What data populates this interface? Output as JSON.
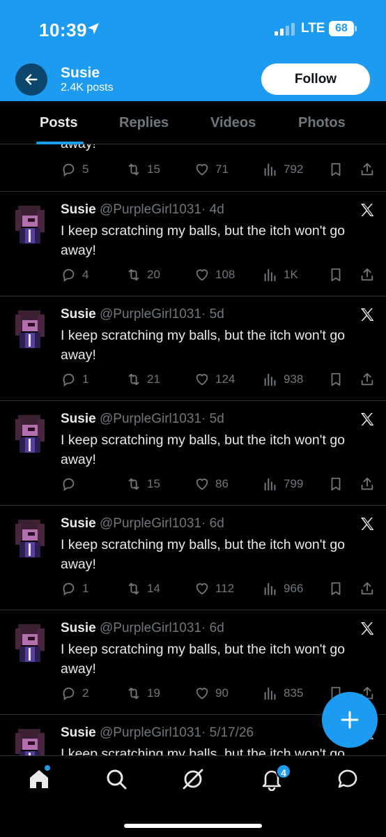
{
  "status_bar": {
    "time": "10:39",
    "network": "LTE",
    "battery": "68"
  },
  "header": {
    "name": "Susie",
    "post_count": "2.4K posts",
    "follow_label": "Follow"
  },
  "tabs": [
    "Posts",
    "Replies",
    "Videos",
    "Photos"
  ],
  "partial_tweet": {
    "text_tail": "away!",
    "replies": "5",
    "reposts": "15",
    "likes": "71",
    "views": "792"
  },
  "tweets": [
    {
      "name": "Susie",
      "handle": "@PurpleGirl1031",
      "time": "· 4d",
      "text": "I keep scratching my balls, but the itch won't go away!",
      "replies": "4",
      "reposts": "20",
      "likes": "108",
      "views": "1K"
    },
    {
      "name": "Susie",
      "handle": "@PurpleGirl1031",
      "time": "· 5d",
      "text": "I keep scratching my balls, but the itch won't go away!",
      "replies": "1",
      "reposts": "21",
      "likes": "124",
      "views": "938"
    },
    {
      "name": "Susie",
      "handle": "@PurpleGirl1031",
      "time": "· 5d",
      "text": "I keep scratching my balls, but the itch won't go away!",
      "replies": "",
      "reposts": "15",
      "likes": "86",
      "views": "799"
    },
    {
      "name": "Susie",
      "handle": "@PurpleGirl1031",
      "time": "· 6d",
      "text": "I keep scratching my balls, but the itch won't go away!",
      "replies": "1",
      "reposts": "14",
      "likes": "112",
      "views": "966"
    },
    {
      "name": "Susie",
      "handle": "@PurpleGirl1031",
      "time": "· 6d",
      "text": "I keep scratching my balls, but the itch won't go away!",
      "replies": "2",
      "reposts": "19",
      "likes": "90",
      "views": "835"
    },
    {
      "name": "Susie",
      "handle": "@PurpleGirl1031",
      "time": "· 5/17/26",
      "text": "I keep scratching my balls, but the itch won't go",
      "replies": "",
      "reposts": "",
      "likes": "",
      "views": ""
    }
  ],
  "bottom_nav": {
    "items": [
      "home-icon",
      "search-icon",
      "grok-icon",
      "bell-icon",
      "messages-icon"
    ],
    "notification_count": "4"
  },
  "colors": {
    "accent": "#1d9bf0",
    "muted": "#71767b",
    "text": "#e7e9ea",
    "divider": "#2f3336"
  }
}
